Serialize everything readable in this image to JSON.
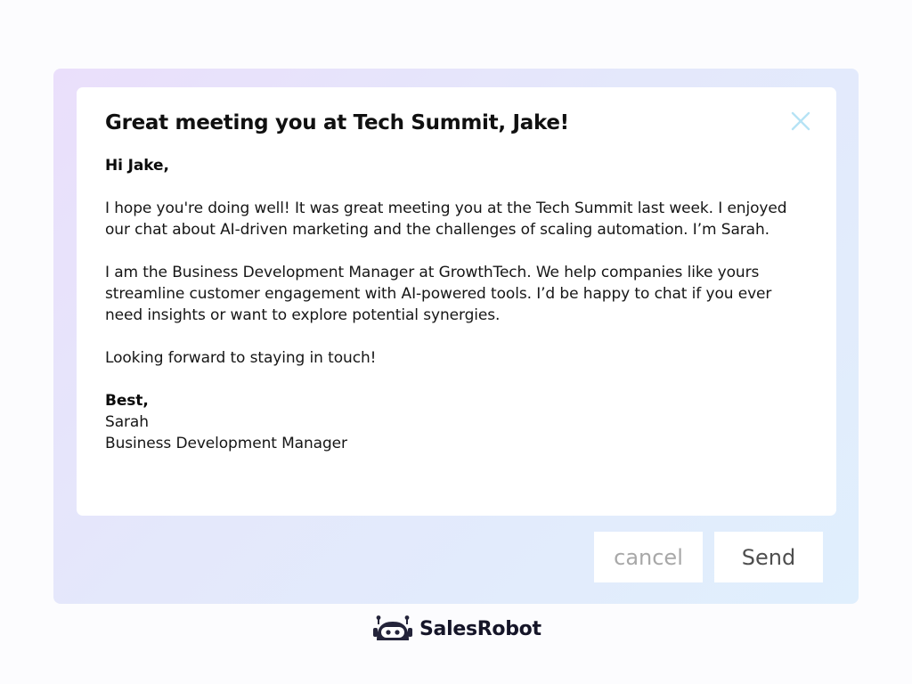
{
  "email": {
    "subject": "Great meeting you at Tech Summit, Jake!",
    "greeting": "Hi Jake,",
    "paragraphs": [
      "I hope you're doing well! It was great meeting you at the Tech Summit last week. I enjoyed our chat about AI-driven marketing and the challenges of scaling automation. I’m Sarah.",
      "I am the Business Development Manager at GrowthTech. We help companies like yours streamline customer engagement with AI-powered tools. I’d be happy to chat if you ever need insights or want to explore potential synergies.",
      "Looking forward to staying in touch!"
    ],
    "signoff": "Best,",
    "signature_name": "Sarah",
    "signature_title": "Business Development Manager"
  },
  "actions": {
    "cancel_label": "cancel",
    "send_label": "Send"
  },
  "icons": {
    "close": "close-icon",
    "brand": "robot-logo-icon"
  },
  "brand": {
    "name": "SalesRobot"
  },
  "colors": {
    "close_icon": "#b6e3f5",
    "panel_gradient_start": "#eadffb",
    "panel_gradient_end": "#e0effd",
    "brand_dark": "#24243a"
  }
}
